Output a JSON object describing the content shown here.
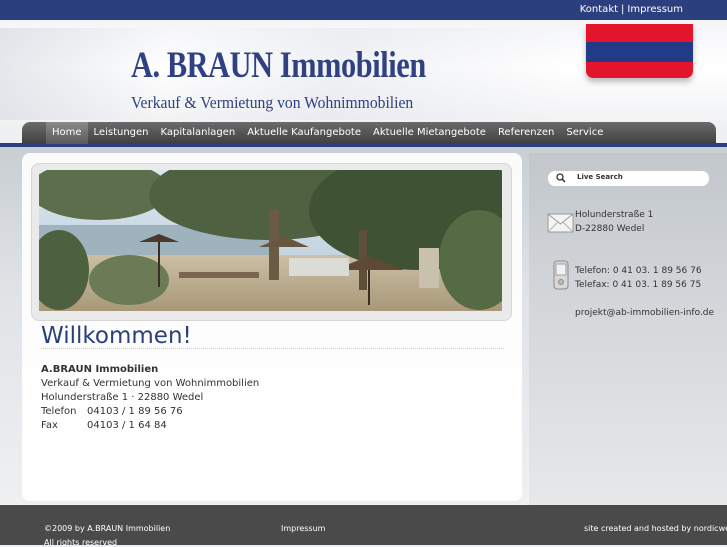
{
  "topbar": {
    "kontakt": "Kontakt",
    "separator": "|",
    "impressum": "Impressum"
  },
  "header": {
    "title": "A. BRAUN Immobilien",
    "subtitle": "Verkauf & Vermietung von Wohnimmobilien"
  },
  "colors": {
    "brand_blue": "#2b3f7e",
    "flag_red": "#e3142c",
    "flag_blue": "#233a86"
  },
  "nav": {
    "items": [
      {
        "label": "Home"
      },
      {
        "label": "Leistungen"
      },
      {
        "label": "Kapitalanlagen"
      },
      {
        "label": "Aktuelle Kaufangebote"
      },
      {
        "label": "Aktuelle Mietangebote"
      },
      {
        "label": "Referenzen"
      },
      {
        "label": "Service"
      }
    ],
    "active": "Home"
  },
  "main": {
    "heading": "Willkommen!",
    "company": "A.BRAUN Immobilien",
    "tagline": "Verkauf & Vermietung von Wohnimmobilien",
    "address": "Holunderstraße 1 · 22880 Wedel",
    "phone_label": "Telefon",
    "phone": "04103 / 1 89 56 76",
    "fax_label": "Fax",
    "fax": "04103 / 1 64 84"
  },
  "sidebar": {
    "search_placeholder": "Live Search",
    "search_icon": "magnifier-icon",
    "street": "Holunderstraße 1",
    "city": "D-22880 Wedel",
    "telefon": "Telefon: 0 41 03. 1 89 56 76",
    "telefax": "Telefax: 0 41 03. 1 89 56 75",
    "email": "projekt@ab-immobilien-info.de",
    "mail_icon": "envelope-icon",
    "phone_icon": "mobile-phone-icon"
  },
  "footer": {
    "copyright": "©2009 by A.BRAUN Immobilien",
    "rights": "All rights reserved",
    "impressum": "Impressum",
    "credit": "site created and hosted by nordicweb"
  }
}
